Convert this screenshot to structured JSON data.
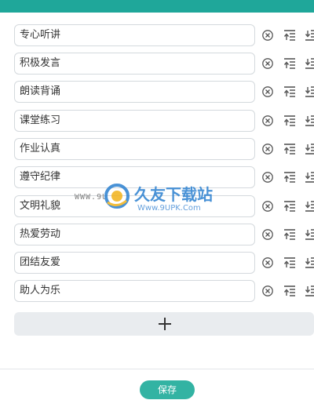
{
  "items": [
    {
      "text": "专心听讲"
    },
    {
      "text": "积极发言"
    },
    {
      "text": "朗读背诵"
    },
    {
      "text": "课堂练习"
    },
    {
      "text": "作业认真"
    },
    {
      "text": "遵守纪律"
    },
    {
      "text": "文明礼貌"
    },
    {
      "text": "热爱劳动"
    },
    {
      "text": "团结友爱"
    },
    {
      "text": "助人为乐"
    }
  ],
  "row_icons": {
    "delete": "circle-x-icon",
    "move_top": "move-to-top-icon",
    "move_bottom": "move-to-bottom-icon"
  },
  "add_button": {
    "icon": "plus-icon"
  },
  "save_button": {
    "label": "保存"
  },
  "watermark": {
    "left_text": "WWW.9U",
    "title": "久友下载站",
    "subtitle": "Www.9UPK.Com"
  },
  "colors": {
    "header": "#1fa79a",
    "save_button": "#33b3a3",
    "watermark_blue": "#2a7fd0"
  }
}
